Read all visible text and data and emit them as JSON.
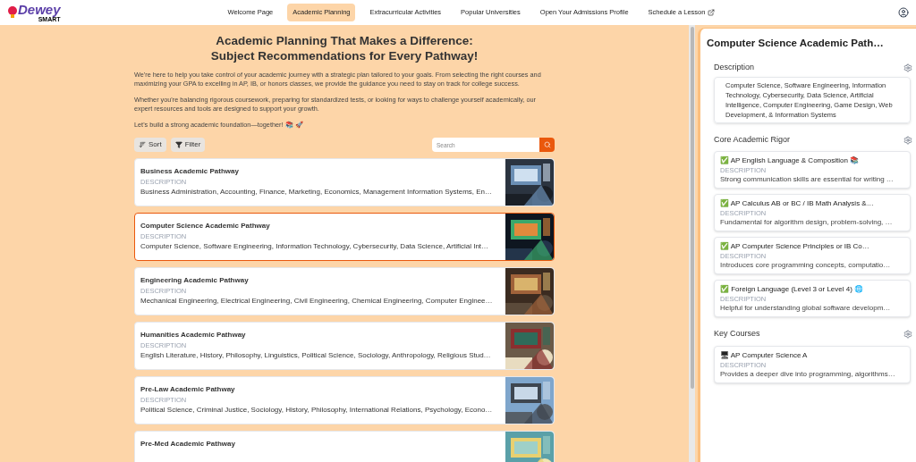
{
  "logo": {
    "word": "Dewey",
    "sub": "SMART"
  },
  "nav": [
    {
      "label": "Welcome Page",
      "selected": false,
      "external": false
    },
    {
      "label": "Academic Planning",
      "selected": true,
      "external": false
    },
    {
      "label": "Extracurricular Activities",
      "selected": false,
      "external": false
    },
    {
      "label": "Popular Universities",
      "selected": false,
      "external": false
    },
    {
      "label": "Open Your Admissions Profile",
      "selected": false,
      "external": false
    },
    {
      "label": "Schedule a Lesson",
      "selected": false,
      "external": true
    }
  ],
  "heading": [
    "Academic Planning That Makes a Difference:",
    "Subject Recommendations for Every Pathway!"
  ],
  "intro": [
    "We're here to help you take control of your academic journey with a strategic plan tailored to your goals. From selecting the right courses and maximizing your GPA to excelling in AP, IB, or honors classes, we provide the guidance you need to stay on track for college success.",
    "Whether you're balancing rigorous coursework, preparing for standardized tests, or looking for ways to challenge yourself academically, our expert resources and tools are designed to support your growth.",
    "Let's build a strong academic foundation—together! 📚 🚀"
  ],
  "toolbar": {
    "sort": "Sort",
    "filter": "Filter",
    "search": {
      "placeholder": "Search"
    }
  },
  "pathways": [
    {
      "title": "Business Academic Pathway",
      "label": "DESCRIPTION",
      "text": "Business Administration, Accounting, Finance, Marketing, Economics, Management Information Systems, En…",
      "selected": false
    },
    {
      "title": "Computer Science Academic Pathway",
      "label": "DESCRIPTION",
      "text": "Computer Science, Software Engineering, Information Technology, Cybersecurity, Data Science, Artificial Int…",
      "selected": true
    },
    {
      "title": "Engineering Academic Pathway",
      "label": "DESCRIPTION",
      "text": "Mechanical Engineering, Electrical Engineering, Civil Engineering, Chemical Engineering, Computer Enginee…",
      "selected": false
    },
    {
      "title": "Humanities Academic Pathway",
      "label": "DESCRIPTION",
      "text": "English Literature, History, Philosophy, Linguistics, Political Science, Sociology, Anthropology, Religious Stud…",
      "selected": false
    },
    {
      "title": "Pre-Law Academic Pathway",
      "label": "DESCRIPTION",
      "text": "Political Science, Criminal Justice, Sociology, History, Philosophy, International Relations, Psychology, Econo…",
      "selected": false
    },
    {
      "title": "Pre-Med Academic Pathway",
      "selected": false
    }
  ],
  "detail": {
    "title": "Computer Science Academic Path…",
    "description": {
      "heading": "Description",
      "text": "Computer Science, Software Engineering, Information Technology, Cybersecurity, Data Science, Artificial Intelligence, Computer Engineering, Game Design, Web Development, & Information Systems"
    },
    "core": {
      "heading": "Core Academic Rigor",
      "items": [
        {
          "title": "✅ AP English Language & Composition 📚",
          "label": "DESCRIPTION",
          "text": "Strong communication skills are essential for writing …"
        },
        {
          "title": "✅ AP Calculus AB or BC / IB Math Analysis &…",
          "label": "DESCRIPTION",
          "text": "Fundamental for algorithm design, problem-solving, …"
        },
        {
          "title": "✅ AP Computer Science Principles or IB Co…",
          "label": "DESCRIPTION",
          "text": "Introduces core programming concepts, computatio…"
        },
        {
          "title": "✅ Foreign Language (Level 3 or Level 4) 🌐",
          "label": "DESCRIPTION",
          "text": "Helpful for understanding global software developm…"
        }
      ]
    },
    "key": {
      "heading": "Key Courses",
      "items": [
        {
          "title": "🖥 AP Computer Science A",
          "label": "DESCRIPTION",
          "text": "Provides a deeper dive into programming, algorithms…"
        }
      ]
    }
  }
}
